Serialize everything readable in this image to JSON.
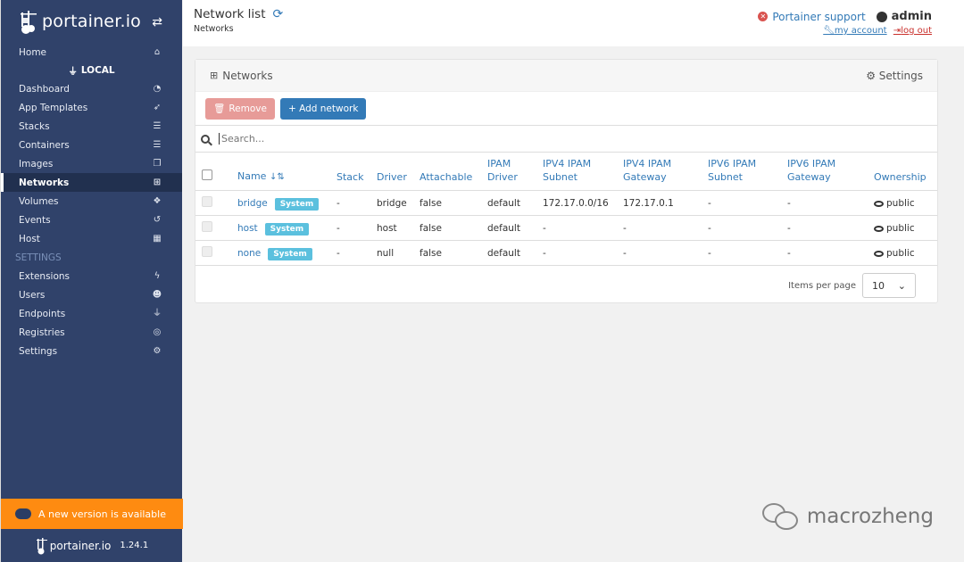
{
  "brand": {
    "name": "portainer.io",
    "version": "1.24.1"
  },
  "sidebar": {
    "home": "Home",
    "endpoint": "LOCAL",
    "items": [
      {
        "label": "Dashboard",
        "icon": "tachometer-icon"
      },
      {
        "label": "App Templates",
        "icon": "rocket-icon"
      },
      {
        "label": "Stacks",
        "icon": "th-list-icon"
      },
      {
        "label": "Containers",
        "icon": "list-icon"
      },
      {
        "label": "Images",
        "icon": "clone-icon"
      },
      {
        "label": "Networks",
        "icon": "sitemap-icon"
      },
      {
        "label": "Volumes",
        "icon": "cubes-icon"
      },
      {
        "label": "Events",
        "icon": "history-icon"
      },
      {
        "label": "Host",
        "icon": "th-icon"
      }
    ],
    "settings_section": "SETTINGS",
    "settings_items": [
      {
        "label": "Extensions",
        "icon": "bolt-icon"
      },
      {
        "label": "Users",
        "icon": "users-icon"
      },
      {
        "label": "Endpoints",
        "icon": "plug-icon"
      },
      {
        "label": "Registries",
        "icon": "database-icon"
      },
      {
        "label": "Settings",
        "icon": "cogs-icon"
      }
    ],
    "update_notice": "A new version is available"
  },
  "header": {
    "title": "Network list",
    "breadcrumb": "Networks",
    "support": "Portainer support",
    "user": "admin",
    "my_account": "my account",
    "logout": "log out"
  },
  "panel": {
    "title": "Networks",
    "settings": "Settings",
    "remove": "Remove",
    "add": "+ Add network",
    "search_placeholder": "Search..."
  },
  "table": {
    "columns": [
      "Name",
      "Stack",
      "Driver",
      "Attachable",
      "IPAM Driver",
      "IPV4 IPAM Subnet",
      "IPV4 IPAM Gateway",
      "IPV6 IPAM Subnet",
      "IPV6 IPAM Gateway",
      "Ownership"
    ],
    "rows": [
      {
        "name": "bridge",
        "badge": "System",
        "stack": "-",
        "driver": "bridge",
        "attachable": "false",
        "ipam": "default",
        "v4sub": "172.17.0.0/16",
        "v4gw": "172.17.0.1",
        "v6sub": "-",
        "v6gw": "-",
        "own": "public"
      },
      {
        "name": "host",
        "badge": "System",
        "stack": "-",
        "driver": "host",
        "attachable": "false",
        "ipam": "default",
        "v4sub": "-",
        "v4gw": "-",
        "v6sub": "-",
        "v6gw": "-",
        "own": "public"
      },
      {
        "name": "none",
        "badge": "System",
        "stack": "-",
        "driver": "null",
        "attachable": "false",
        "ipam": "default",
        "v4sub": "-",
        "v4gw": "-",
        "v6sub": "-",
        "v6gw": "-",
        "own": "public"
      }
    ],
    "items_per_page_label": "Items per page",
    "items_per_page": "10"
  },
  "watermark": "macrozheng",
  "colors": {
    "sidebar": "#30426a",
    "accent": "#337ab7",
    "warning": "#fe8b11",
    "badge": "#5bc0de",
    "danger": "#d9534f"
  }
}
